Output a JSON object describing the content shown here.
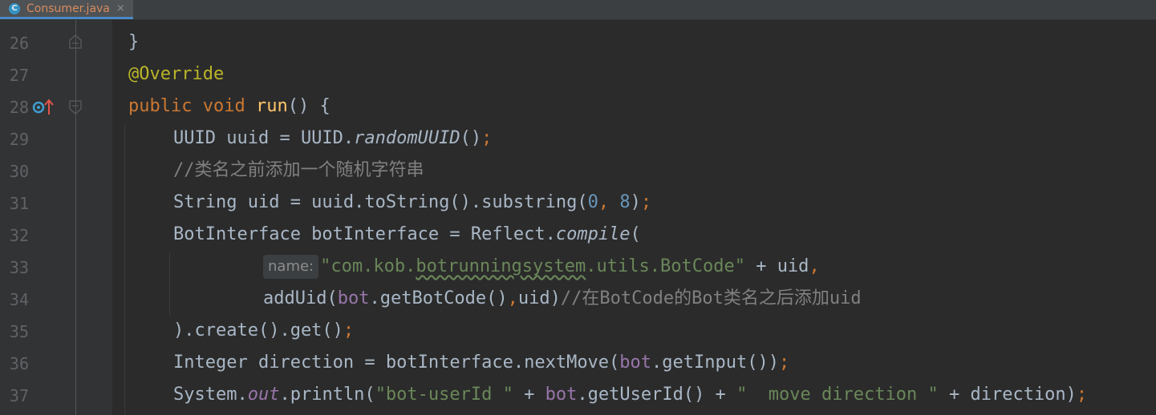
{
  "tab": {
    "icon": "C",
    "filename": "Consumer.java",
    "close": "×"
  },
  "lines": {
    "n26": "26",
    "n27": "27",
    "n28": "28",
    "n29": "29",
    "n30": "30",
    "n31": "31",
    "n32": "32",
    "n33": "33",
    "n34": "34",
    "n35": "35",
    "n36": "36",
    "n37": "37"
  },
  "code": {
    "l26": {
      "brace": "}"
    },
    "l27": {
      "annotation": "@Override"
    },
    "l28": {
      "kw1": "public",
      "kw2": "void",
      "fn": "run",
      "rest": "() {"
    },
    "l29": {
      "a": "UUID uuid = UUID.",
      "b": "randomUUID",
      "c": "()",
      "semi": ";"
    },
    "l30": {
      "comment": "//类名之前添加一个随机字符串"
    },
    "l31": {
      "a": "String uid = uuid.toString().substring(",
      "n0": "0",
      "comma": ",",
      "sp": " ",
      "n8": "8",
      "close": ")",
      "semi": ";"
    },
    "l32": {
      "a": "BotInterface botInterface = Reflect.",
      "b": "compile",
      "c": "("
    },
    "l33": {
      "hint": "name:",
      "s1": "\"com.kob.",
      "squig": "botrunningsystem",
      "s2": ".utils.BotCode\"",
      "rest": " + uid",
      "comma": ","
    },
    "l34": {
      "a": "addUid(",
      "bot": "bot",
      "b": ".getBotCode()",
      "comma": ",",
      "c": "uid)",
      "comment": "//在BotCode的Bot类名之后添加uid"
    },
    "l35": {
      "a": ").create().get()",
      "semi": ";"
    },
    "l36": {
      "a": "Integer direction = botInterface.nextMove(",
      "bot": "bot",
      "b": ".getInput())",
      "semi": ";"
    },
    "l37": {
      "a": "System.",
      "out": "out",
      "b": ".println(",
      "s1": "\"bot-userId \"",
      "c": " + ",
      "bot": "bot",
      "d": ".getUserId() + ",
      "s2": "\"  move direction \"",
      "e": " + direction)",
      "semi": ";"
    }
  },
  "colors": {
    "background": "#2b2b2b",
    "keyword": "#cc7832",
    "string": "#6a8759",
    "number": "#6897bb",
    "comment": "#808080",
    "annotation": "#bbb529",
    "method_decl": "#ffc66d",
    "field": "#9876aa"
  },
  "icons": {
    "tab": "java-class-icon",
    "line28": "implements-method-icon",
    "fold": "fold-marker-icon"
  }
}
